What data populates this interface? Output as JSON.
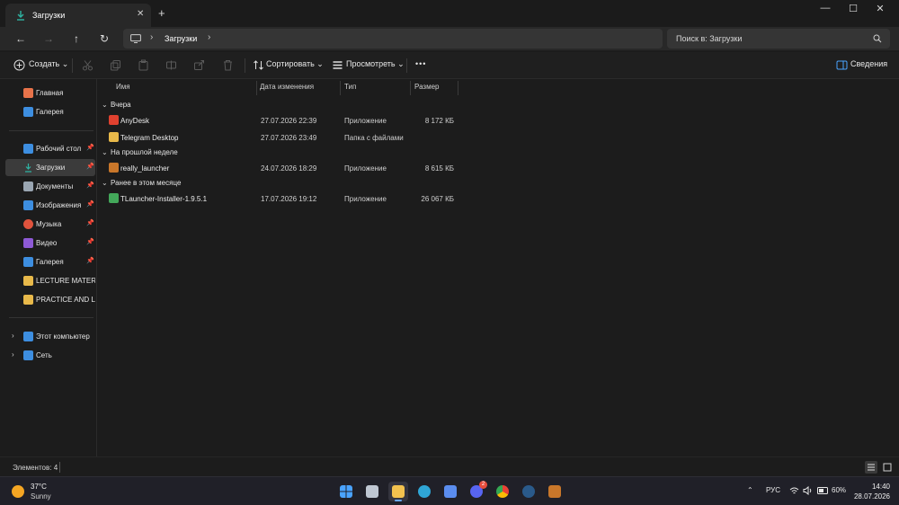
{
  "tab": {
    "title": "Загрузки",
    "close": "✕",
    "new_tab": "+"
  },
  "window": {
    "minimize": "—",
    "maximize": "☐",
    "close": "✕"
  },
  "address": {
    "crumb": "Загрузки",
    "sep1": "›",
    "sep2": "›"
  },
  "search": {
    "placeholder": "Поиск в: Загрузки"
  },
  "commands": {
    "create": "Создать",
    "sort": "Сортировать",
    "view": "Просмотреть",
    "more": "•••",
    "details": "Сведения",
    "caret": "⌄"
  },
  "sidebar": {
    "quick": [
      {
        "label": "Главная",
        "icon": "home-icon",
        "color": "#e8734a"
      },
      {
        "label": "Галерея",
        "icon": "gallery-icon",
        "color": "#3d8ee0"
      }
    ],
    "pinned": [
      {
        "label": "Рабочий стол",
        "icon": "desktop-icon",
        "color": "#3d8ee0",
        "pin": true
      },
      {
        "label": "Загрузки",
        "icon": "downloads-icon",
        "color": "#2fb3a2",
        "pin": true,
        "active": true
      },
      {
        "label": "Документы",
        "icon": "documents-icon",
        "color": "#9aa6b2",
        "pin": true
      },
      {
        "label": "Изображения",
        "icon": "pictures-icon",
        "color": "#3d8ee0",
        "pin": true
      },
      {
        "label": "Музыка",
        "icon": "music-icon",
        "color": "#e0533d",
        "pin": true
      },
      {
        "label": "Видео",
        "icon": "video-icon",
        "color": "#8e5ad6",
        "pin": true
      },
      {
        "label": "Галерея",
        "icon": "gallery-icon",
        "color": "#3d8ee0",
        "pin": true
      },
      {
        "label": "LECTURE MATERIALS",
        "icon": "folder-icon",
        "color": "#e8b94a",
        "pin": false
      },
      {
        "label": "PRACTICE AND LABS",
        "icon": "folder-icon",
        "color": "#e8b94a",
        "pin": false
      }
    ],
    "pin_glyph": "📌",
    "expand_glyph": "›",
    "tree": [
      {
        "label": "Этот компьютер",
        "icon": "computer-icon",
        "color": "#3d8ee0"
      },
      {
        "label": "Сеть",
        "icon": "network-icon",
        "color": "#3d8ee0"
      }
    ]
  },
  "columns": {
    "name": "Имя",
    "date": "Дата изменения",
    "type": "Тип",
    "size": "Размер"
  },
  "groups": [
    {
      "label": "Вчера",
      "files": [
        {
          "name": "AnyDesk",
          "date": "27.07.2026 22:39",
          "type": "Приложение",
          "size": "8 172 КБ",
          "icon": "anydesk-icon",
          "color": "#e0412f"
        },
        {
          "name": "Telegram Desktop",
          "date": "27.07.2026 23:49",
          "type": "Папка с файлами",
          "size": "",
          "icon": "folder-icon",
          "color": "#e8b94a"
        }
      ]
    },
    {
      "label": "На прошлой неделе",
      "files": [
        {
          "name": "really_launcher",
          "date": "24.07.2026 18:29",
          "type": "Приложение",
          "size": "8 615 КБ",
          "icon": "launcher-icon",
          "color": "#c9772a"
        }
      ]
    },
    {
      "label": "Ранее в этом месяце",
      "files": [
        {
          "name": "TLauncher-Installer-1.9.5.1",
          "date": "17.07.2026 19:12",
          "type": "Приложение",
          "size": "26 067 КБ",
          "icon": "tlauncher-icon",
          "color": "#43a85a"
        }
      ]
    }
  ],
  "status": {
    "count": "Элементов: 4"
  },
  "taskbar": {
    "weather_temp": "37°C",
    "weather_desc": "Sunny",
    "apps": [
      {
        "name": "windows-start-icon",
        "color": "#4aa3ff"
      },
      {
        "name": "task-view-icon",
        "color": "#bfc7d2"
      },
      {
        "name": "file-explorer-icon",
        "color": "#f2c14e",
        "active": true
      },
      {
        "name": "edge-icon",
        "color": "#2fa6d6"
      },
      {
        "name": "store-icon",
        "color": "#5b8def"
      },
      {
        "name": "discord-icon",
        "color": "#5865f2",
        "badge": "2"
      },
      {
        "name": "chrome-icon",
        "color": "#e94235"
      },
      {
        "name": "steam-icon",
        "color": "#2a5a8a"
      },
      {
        "name": "really-launcher-icon",
        "color": "#c9772a"
      }
    ],
    "lang": "РУС",
    "chevron": "⌃",
    "battery": "60%",
    "time": "14:40",
    "date": "28.07.2026"
  }
}
